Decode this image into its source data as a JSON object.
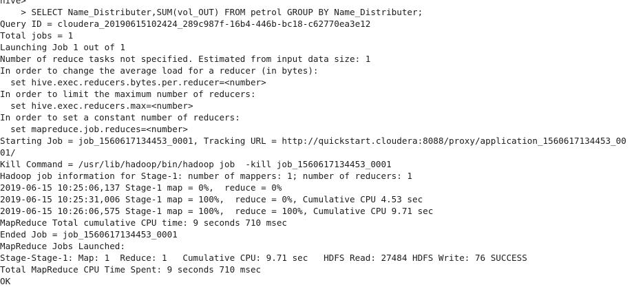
{
  "terminal": {
    "lines": [
      "hive>",
      "    > SELECT Name_Distributer,SUM(vol_OUT) FROM petrol GROUP BY Name_Distributer;",
      "Query ID = cloudera_20190615102424_289c987f-16b4-446b-bc18-c62770ea3e12",
      "Total jobs = 1",
      "Launching Job 1 out of 1",
      "Number of reduce tasks not specified. Estimated from input data size: 1",
      "In order to change the average load for a reducer (in bytes):",
      "  set hive.exec.reducers.bytes.per.reducer=<number>",
      "In order to limit the maximum number of reducers:",
      "  set hive.exec.reducers.max=<number>",
      "In order to set a constant number of reducers:",
      "  set mapreduce.job.reduces=<number>",
      "Starting Job = job_1560617134453_0001, Tracking URL = http://quickstart.cloudera:8088/proxy/application_1560617134453_00",
      "01/",
      "Kill Command = /usr/lib/hadoop/bin/hadoop job  -kill job_1560617134453_0001",
      "Hadoop job information for Stage-1: number of mappers: 1; number of reducers: 1",
      "2019-06-15 10:25:06,137 Stage-1 map = 0%,  reduce = 0%",
      "2019-06-15 10:25:31,006 Stage-1 map = 100%,  reduce = 0%, Cumulative CPU 4.53 sec",
      "2019-06-15 10:26:06,575 Stage-1 map = 100%,  reduce = 100%, Cumulative CPU 9.71 sec",
      "MapReduce Total cumulative CPU time: 9 seconds 710 msec",
      "Ended Job = job_1560617134453_0001",
      "MapReduce Jobs Launched:",
      "Stage-Stage-1: Map: 1  Reduce: 1   Cumulative CPU: 9.71 sec   HDFS Read: 27484 HDFS Write: 76 SUCCESS",
      "Total MapReduce CPU Time Spent: 9 seconds 710 msec",
      "OK"
    ]
  }
}
